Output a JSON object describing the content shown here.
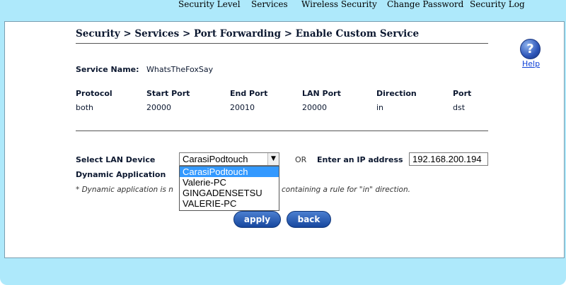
{
  "nav": {
    "items": [
      "Security Level",
      "Services",
      "Wireless Security",
      "Change Password",
      "Security Log"
    ]
  },
  "title": "Security > Services > Port Forwarding > Enable Custom Service",
  "help": {
    "label": "Help",
    "icon": "help-icon"
  },
  "service": {
    "label": "Service Name:",
    "value": "WhatsTheFoxSay"
  },
  "table": {
    "headers": [
      "Protocol",
      "Start Port",
      "End Port",
      "LAN Port",
      "Direction",
      "Port"
    ],
    "row": [
      "both",
      "20000",
      "20010",
      "20000",
      "in",
      "dst"
    ]
  },
  "lan_device": {
    "label": "Select LAN Device",
    "selected": "CarasiPodtouch",
    "options": [
      "CarasiPodtouch",
      "Valerie-PC",
      "GINGADENSETSU",
      "VALERIE-PC"
    ]
  },
  "or_label": "OR",
  "ip": {
    "label": "Enter an IP address",
    "value": "192.168.200.194"
  },
  "dynamic": {
    "label": "Dynamic Application",
    "note_left": "* Dynamic application is n",
    "note_right": "containing a rule for \"in\" direction."
  },
  "buttons": {
    "apply": "apply",
    "back": "back"
  },
  "colors": {
    "frame": "#aee9fb",
    "button": "#17479e",
    "highlight": "#3399ff"
  }
}
